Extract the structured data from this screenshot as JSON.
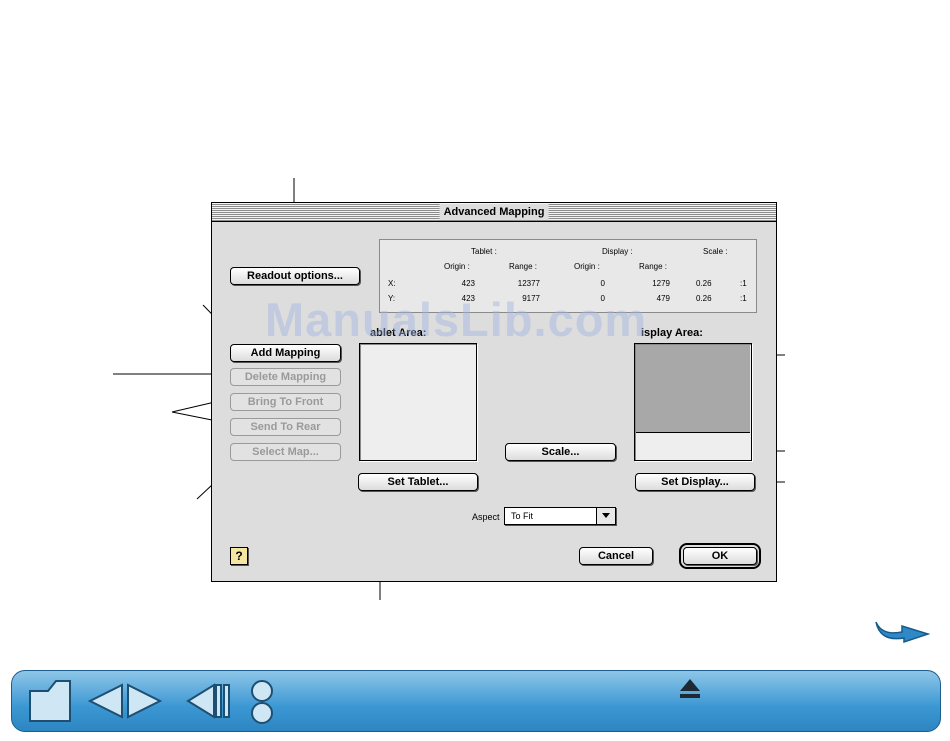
{
  "dialog": {
    "title": "Advanced Mapping",
    "buttons": {
      "readout_options": "Readout options...",
      "add_mapping": "Add Mapping",
      "delete_mapping": "Delete Mapping",
      "bring_to_front": "Bring To Front",
      "send_to_rear": "Send To Rear",
      "select_map": "Select Map...",
      "scale": "Scale...",
      "set_tablet": "Set Tablet...",
      "set_display": "Set Display...",
      "cancel": "Cancel",
      "ok": "OK"
    },
    "readout": {
      "group_headers": {
        "tablet": "Tablet :",
        "display": "Display :",
        "scale": "Scale :"
      },
      "column_headers": [
        "Origin :",
        "Range :",
        "Origin :",
        "Range :"
      ],
      "rows": [
        {
          "axis": "X:",
          "tablet_origin": "423",
          "tablet_range": "12377",
          "display_origin": "0",
          "display_range": "1279",
          "scale": "0.26",
          "ratio": ":1"
        },
        {
          "axis": "Y:",
          "tablet_origin": "423",
          "tablet_range": "9177",
          "display_origin": "0",
          "display_range": "479",
          "scale": "0.26",
          "ratio": ":1"
        }
      ]
    },
    "tablet_area_label": "ablet Area:",
    "display_area_label": "isplay Area:",
    "aspect": {
      "label": "Aspect",
      "value": "To Fit"
    },
    "help_icon": "?"
  },
  "watermark": "ManualsLib.com",
  "colors": {
    "dialog_bg": "#dddddd",
    "display_fill": "#a8a8a8",
    "nav_blue": "#3b97d3"
  }
}
